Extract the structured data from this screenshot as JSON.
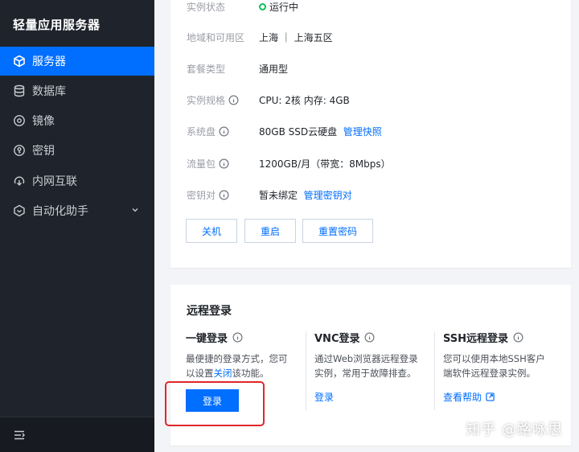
{
  "sidebar": {
    "title": "轻量应用服务器",
    "items": [
      {
        "label": "服务器",
        "icon": "cube-icon"
      },
      {
        "label": "数据库",
        "icon": "database-icon"
      },
      {
        "label": "镜像",
        "icon": "disc-icon"
      },
      {
        "label": "密钥",
        "icon": "key-icon"
      },
      {
        "label": "内网互联",
        "icon": "link-icon"
      },
      {
        "label": "自动化助手",
        "icon": "robot-icon"
      }
    ]
  },
  "instance": {
    "status": {
      "label": "实例状态",
      "value": "运行中"
    },
    "region": {
      "label": "地域和可用区",
      "value": "上海 ｜ 上海五区"
    },
    "package": {
      "label": "套餐类型",
      "value": "通用型"
    },
    "spec": {
      "label": "实例规格",
      "value": "CPU: 2核 内存: 4GB"
    },
    "disk": {
      "label": "系统盘",
      "value": "80GB SSD云硬盘",
      "link": "管理快照"
    },
    "traffic": {
      "label": "流量包",
      "value": "1200GB/月（带宽：8Mbps）"
    },
    "keypair": {
      "label": "密钥对",
      "value": "暂未绑定",
      "link": "管理密钥对"
    },
    "buttons": {
      "shutdown": "关机",
      "restart": "重启",
      "reset_password": "重置密码"
    }
  },
  "remote_login": {
    "title": "远程登录",
    "one_click": {
      "title": "一键登录",
      "desc_line1": "最便捷的登录方式，您可",
      "desc_prefix": "以设置",
      "desc_link": "关闭",
      "desc_suffix": "该功能。",
      "button": "登录"
    },
    "vnc": {
      "title": "VNC登录",
      "desc_line1": "通过Web浏览器远程登录",
      "desc_line2": "实例，常用于故障排查。",
      "action": "登录"
    },
    "ssh": {
      "title": "SSH远程登录",
      "desc_line1": "您可以使用本地SSH客户",
      "desc_line2": "端软件远程登录实例。",
      "action": "查看帮助"
    }
  },
  "watermark": "知乎 @路咏思",
  "colors": {
    "accent": "#006eff",
    "sidebar_bg": "#1f232b",
    "status_green": "#0abf5b",
    "highlight_red": "#e0262b"
  }
}
